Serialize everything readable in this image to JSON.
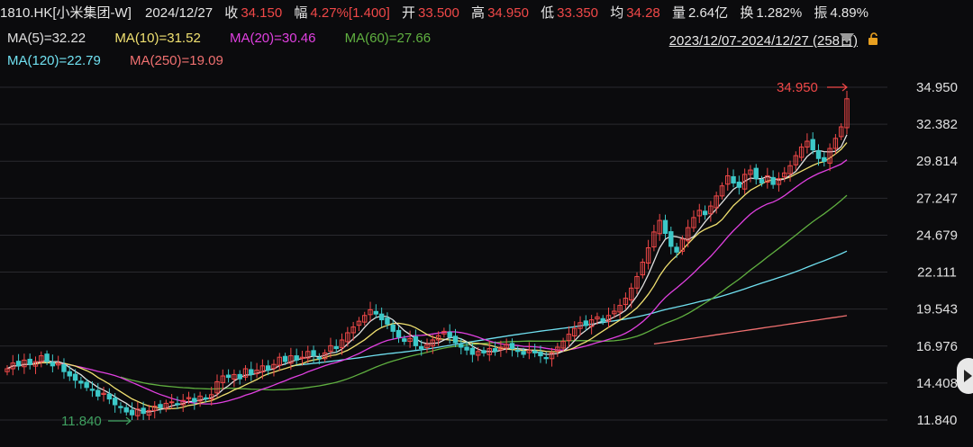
{
  "header": {
    "symbol": "1810.HK[小米集团-W]",
    "date": "2024/12/27",
    "close_label": "收",
    "close": "34.150",
    "amp_label": "幅",
    "amp": "4.27%[1.400]",
    "open_label": "开",
    "open": "33.500",
    "high_label": "高",
    "high": "34.950",
    "low_label": "低",
    "low": "33.350",
    "avg_label": "均",
    "avg": "34.28",
    "vol_label": "量",
    "vol": "2.64亿",
    "turnover_label": "换",
    "turnover": "1.282%",
    "swing_label": "振",
    "swing": "4.89%"
  },
  "ma_legend": [
    {
      "text": "MA(5)=32.22",
      "color": "#e0e0e0"
    },
    {
      "text": "MA(10)=31.52",
      "color": "#f0e070"
    },
    {
      "text": "MA(20)=30.46",
      "color": "#e040e0"
    },
    {
      "text": "MA(60)=27.66",
      "color": "#60b040"
    },
    {
      "text": "MA(120)=22.79",
      "color": "#70e0f0"
    },
    {
      "text": "MA(250)=19.09",
      "color": "#f07070"
    }
  ],
  "range": "2023/12/07-2024/12/27 (258日)",
  "colors": {
    "up": "#f04848",
    "down": "#3cc8c8",
    "background": "#0b0b0d"
  },
  "chart_data": {
    "type": "candlestick",
    "y_ticks": [
      "34.950",
      "32.382",
      "29.814",
      "27.247",
      "24.679",
      "22.111",
      "19.543",
      "16.976",
      "14.408",
      "11.840"
    ],
    "ylim": [
      11.84,
      34.95
    ],
    "high_annotation": "34.950",
    "low_annotation": "11.840",
    "close_series": [
      15.4,
      15.8,
      15.6,
      16.0,
      15.7,
      15.9,
      16.3,
      15.9,
      15.6,
      15.8,
      15.2,
      14.9,
      14.6,
      14.4,
      14.1,
      13.9,
      13.5,
      13.7,
      13.3,
      12.9,
      12.7,
      12.4,
      12.2,
      12.6,
      12.3,
      12.5,
      12.8,
      12.7,
      13.0,
      13.1,
      12.9,
      13.2,
      13.4,
      13.1,
      13.5,
      13.3,
      13.6,
      14.5,
      14.9,
      14.8,
      15.0,
      14.7,
      15.4,
      15.0,
      15.3,
      15.6,
      15.3,
      15.7,
      16.2,
      15.9,
      16.3,
      16.0,
      16.2,
      16.6,
      16.3,
      16.1,
      16.5,
      17.0,
      16.8,
      17.4,
      17.9,
      18.3,
      18.7,
      19.1,
      19.5,
      19.2,
      18.8,
      18.5,
      18.0,
      17.6,
      17.3,
      17.5,
      17.0,
      16.8,
      17.1,
      17.4,
      17.7,
      18.0,
      17.6,
      17.2,
      16.9,
      16.7,
      16.4,
      16.6,
      16.5,
      16.8,
      16.6,
      16.9,
      17.1,
      16.8,
      16.6,
      16.4,
      16.7,
      16.5,
      16.3,
      16.1,
      16.5,
      16.9,
      17.3,
      17.8,
      18.2,
      18.6,
      18.4,
      18.8,
      19.0,
      18.7,
      19.1,
      19.4,
      19.8,
      20.3,
      21.0,
      21.8,
      22.8,
      23.8,
      24.9,
      25.7,
      24.8,
      23.9,
      23.5,
      24.4,
      25.2,
      25.9,
      26.4,
      26.1,
      26.7,
      27.4,
      28.1,
      28.8,
      28.3,
      28.0,
      28.9,
      29.2,
      28.6,
      28.3,
      28.8,
      28.2,
      28.6,
      29.0,
      29.5,
      30.2,
      30.8,
      31.2,
      30.6,
      30.0,
      29.8,
      30.7,
      31.4,
      32.2,
      34.15
    ]
  }
}
